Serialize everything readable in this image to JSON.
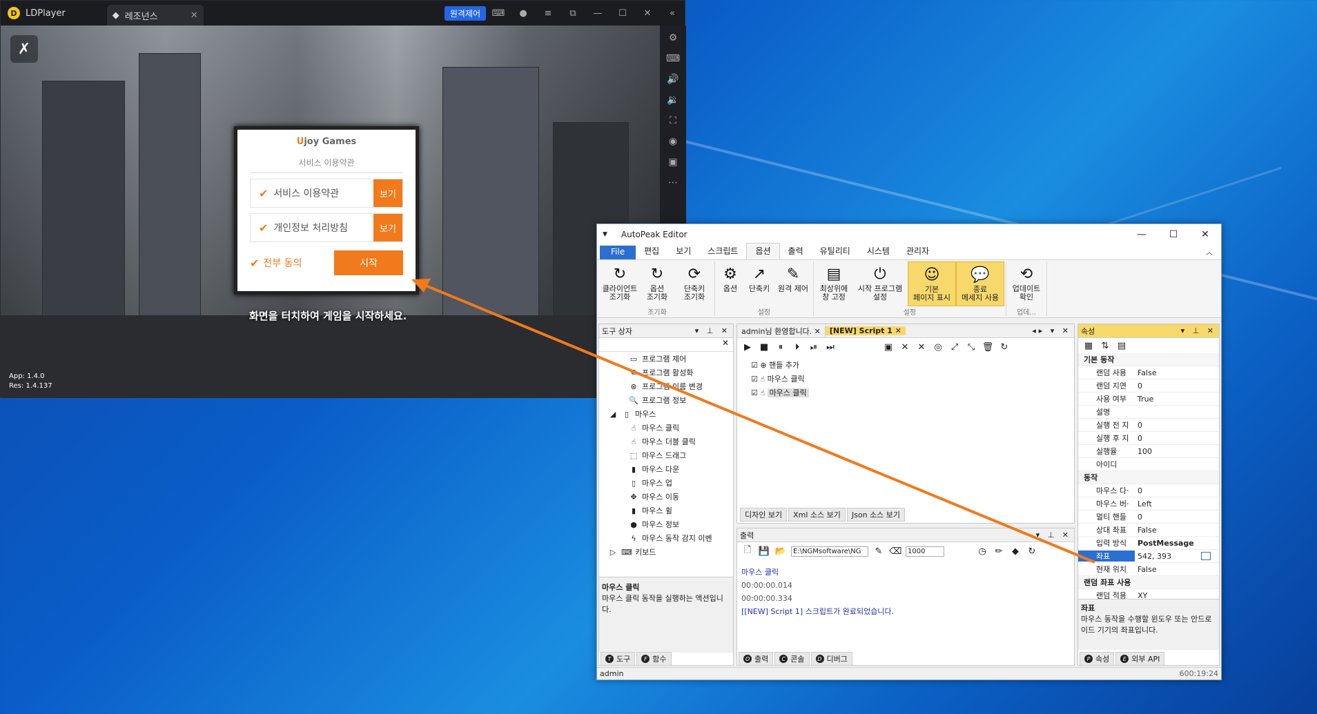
{
  "ldplayer": {
    "app_name": "LDPlayer",
    "tab_label": "레조넌스",
    "remote_label": "원격제어",
    "game": {
      "version_app": "App: 1.4.0",
      "version_res": "Res: 1.4.137",
      "touch_text": "화면을 터치하여 게임을 시작하세요.",
      "dialog": {
        "brand_u": "U",
        "brand_rest": "joy Games",
        "subtitle": "서비스 이용약관",
        "row1_label": "서비스 이용약관",
        "row1_btn": "보기",
        "row2_label": "개인정보 처리방침",
        "row2_btn": "보기",
        "agree_all": "전부 동의",
        "start": "시작"
      }
    }
  },
  "autopeak": {
    "title": "AutoPeak Editor",
    "menu": [
      "File",
      "편집",
      "보기",
      "스크립트",
      "옵션",
      "출력",
      "유틸리티",
      "시스템",
      "관리자"
    ],
    "ribbon": {
      "g1": {
        "label": "조기화",
        "items": [
          "클라이언트\n조기화",
          "옵션\n조기화",
          "단축키\n조기화"
        ]
      },
      "g2": {
        "label": "설정",
        "items": [
          "옵션",
          "단축키",
          "원격 제어"
        ]
      },
      "g3": {
        "label": "설정",
        "items": [
          "최상위에\n창 고정",
          "시작 프로그램\n설정",
          "기본\n페이지 표시",
          "종료\n메세지 사용"
        ]
      },
      "g4": {
        "label": "업데...",
        "items": [
          "업데이트\n확인"
        ]
      }
    },
    "toolbox": {
      "title": "도구 상자",
      "items": [
        "프로그램 제어",
        "프로그램 활성화",
        "프로그램 이름 변경",
        "프로그램 정보",
        "마우스",
        "마우스 클릭",
        "마우스 더블 클릭",
        "마우스 드래그",
        "마우스 다운",
        "마우스 업",
        "마우스 이동",
        "마우스 휠",
        "마우스 정보",
        "마우스 동작 감지 이벤",
        "키보드"
      ],
      "desc_title": "마우스 클릭",
      "desc_text": "마우스 클릭 동작을 실행하는 액션입니다.",
      "tabs": [
        "도구",
        "함수"
      ]
    },
    "editor": {
      "tab1": "admin님 환영합니다.",
      "tab2": "[NEW] Script 1",
      "steps": [
        "핸들 추가",
        "마우스 클릭",
        "마우스 클릭"
      ],
      "view_tabs": [
        "디자인 보기",
        "Xml 소스 보기",
        "Json 소스 보기"
      ]
    },
    "output": {
      "title": "출력",
      "path": "E:\\NGMsoftware\\NG",
      "count": "1000",
      "lines": [
        "마우스 클릭",
        "00:00:00.014",
        "00:00:00.334",
        "[[NEW] Script 1] 스크립트가 완료되었습니다."
      ],
      "tabs": [
        "출력",
        "콘솔",
        "디버그"
      ]
    },
    "props": {
      "title": "속성",
      "rows": [
        {
          "k": "기본 동작",
          "v": "",
          "cat": true
        },
        {
          "k": "랜덤 사용",
          "v": "False"
        },
        {
          "k": "랜덤 지연",
          "v": "0"
        },
        {
          "k": "사용 여부",
          "v": "True"
        },
        {
          "k": "설명",
          "v": ""
        },
        {
          "k": "실행 전 지",
          "v": "0"
        },
        {
          "k": "실행 후 지",
          "v": "0"
        },
        {
          "k": "실행율",
          "v": "100"
        },
        {
          "k": "아이디",
          "v": ""
        },
        {
          "k": "동작",
          "v": "",
          "cat": true
        },
        {
          "k": "마우스 다·",
          "v": "0"
        },
        {
          "k": "마우스 버·",
          "v": "Left"
        },
        {
          "k": "멀티 핸들",
          "v": "0"
        },
        {
          "k": "상대 좌표",
          "v": "False"
        },
        {
          "k": "입력 방식",
          "v": "PostMessage"
        },
        {
          "k": "좌표",
          "v": "542, 393",
          "sel": true
        },
        {
          "k": "현재 위치",
          "v": "False"
        },
        {
          "k": "랜덤 좌표 사용",
          "v": "",
          "cat": true
        },
        {
          "k": "랜덤 적용",
          "v": "XY"
        }
      ],
      "desc_title": "좌표",
      "desc_text": "마우스 동작을 수행할 윈도우 또는 안드로이드 기기의 좌표입니다.",
      "tabs": [
        "속성",
        "외부 API"
      ]
    },
    "status_left": "admin",
    "status_right": "600:19:24"
  }
}
